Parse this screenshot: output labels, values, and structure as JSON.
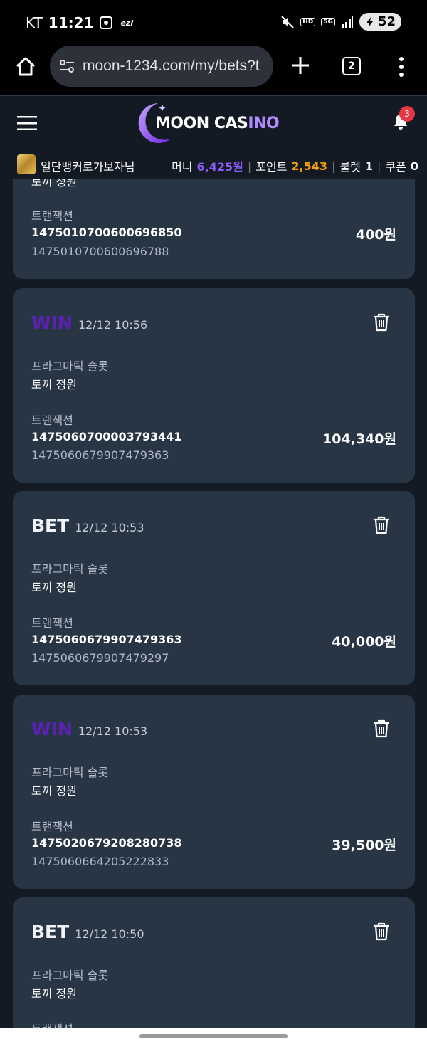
{
  "status_bar": {
    "carrier": "KT",
    "time": "11:21",
    "small_label": "ezl",
    "hd_badge": "HD",
    "network": "5G",
    "battery": "52"
  },
  "browser": {
    "url": "moon-1234.com/my/bets?t",
    "tab_count": "2"
  },
  "site": {
    "logo_prefix": "MOON CAS",
    "logo_highlight": "INO",
    "notifications": "3"
  },
  "user": {
    "name": "일단뱅커로가보자님",
    "money_label": "머니",
    "money_value": "6,425원",
    "point_label": "포인트",
    "point_value": "2,543",
    "roulette_label": "룰렛",
    "roulette_value": "1",
    "coupon_label": "쿠폰",
    "coupon_value": "0"
  },
  "cards": [
    {
      "game": "토끼 정원",
      "tx_label": "트랜잭션",
      "tx_id": "1475010700600696850",
      "tx_ref": "1475010700600696788",
      "amount": "400원"
    },
    {
      "type": "WIN",
      "time": "12/12 10:56",
      "provider": "프라그마틱 슬롯",
      "game": "토끼 정원",
      "tx_label": "트랜잭션",
      "tx_id": "1475060700003793441",
      "tx_ref": "1475060679907479363",
      "amount": "104,340원"
    },
    {
      "type": "BET",
      "time": "12/12 10:53",
      "provider": "프라그마틱 슬롯",
      "game": "토끼 정원",
      "tx_label": "트랜잭션",
      "tx_id": "1475060679907479363",
      "tx_ref": "1475060679907479297",
      "amount": "40,000원"
    },
    {
      "type": "WIN",
      "time": "12/12 10:53",
      "provider": "프라그마틱 슬롯",
      "game": "토끼 정원",
      "tx_label": "트랜잭션",
      "tx_id": "1475020679208280738",
      "tx_ref": "1475060664205222833",
      "amount": "39,500원"
    },
    {
      "type": "BET",
      "time": "12/12 10:50",
      "provider": "프라그마틱 슬롯",
      "game": "토끼 정원",
      "tx_label": "트랜잭션"
    }
  ],
  "colors": {
    "win": "#5b21b6",
    "card_bg": "#283545",
    "page_bg": "#141a23",
    "money": "#8b5cf6",
    "point": "#f59e0b"
  }
}
